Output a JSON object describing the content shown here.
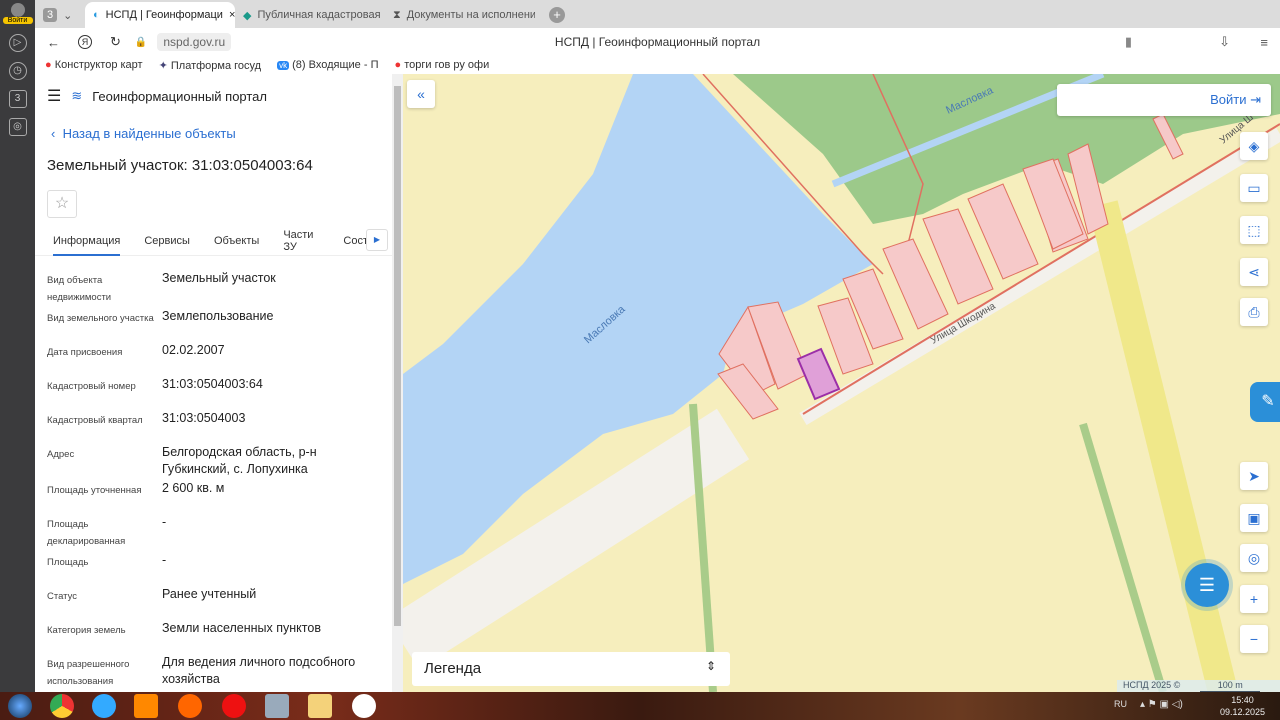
{
  "browser": {
    "profile_label": "Войти",
    "tab_count": "3",
    "tabs": [
      {
        "label": "НСПД | Геоинформаци"
      },
      {
        "label": "Публичная кадастровая"
      },
      {
        "label": "Документы на исполнени"
      }
    ],
    "url": "nspd.gov.ru",
    "page_title": "НСПД | Геоинформационный портал",
    "bookmarks": [
      "Конструктор карт",
      "Платформа госуд",
      "(8) Входящие - П",
      "торги гов ру офи"
    ]
  },
  "panel": {
    "app_name": "Геоинформационный портал",
    "back_label": "Назад в найденные объекты",
    "title": "Земельный участок: 31:03:0504003:64",
    "tabs": [
      "Информация",
      "Сервисы",
      "Объекты",
      "Части ЗУ",
      "Соста"
    ],
    "rows": [
      {
        "k": "Вид объекта недвижимости",
        "v": "Земельный участок"
      },
      {
        "k": "Вид земельного участка",
        "v": "Землепользование"
      },
      {
        "k": "Дата присвоения",
        "v": "02.02.2007"
      },
      {
        "k": "Кадастровый номер",
        "v": "31:03:0504003:64"
      },
      {
        "k": "Кадастровый квартал",
        "v": "31:03:0504003"
      },
      {
        "k": "Адрес",
        "v": "Белгородская область, р-н Губкинский, с. Лопухинка"
      },
      {
        "k": "Площадь уточненная",
        "v": "2 600 кв. м"
      },
      {
        "k": "Площадь декларированная",
        "v": "-"
      },
      {
        "k": "Площадь",
        "v": "-"
      },
      {
        "k": "Статус",
        "v": "Ранее учтенный"
      },
      {
        "k": "Категория земель",
        "v": "Земли населенных пунктов"
      },
      {
        "k": "Вид разрешенного использования",
        "v": "Для ведения личного подсобного хозяйства"
      }
    ]
  },
  "map": {
    "login_label": "Войти",
    "legend_label": "Легенда",
    "copyright": "НСПД 2025 ©",
    "scale": "100 m",
    "labels": {
      "river1": "Масловка",
      "river2": "Масловка",
      "street1": "Улица Шкодина",
      "street2": "Улица Ш"
    }
  },
  "taskbar": {
    "lang": "RU",
    "time": "15:40",
    "date": "09.12.2025"
  },
  "colors": {
    "accent": "#2b6fd1",
    "water": "#b3d4f5",
    "parcel": "#f6c9c9",
    "selected": "#9b2fa8"
  }
}
